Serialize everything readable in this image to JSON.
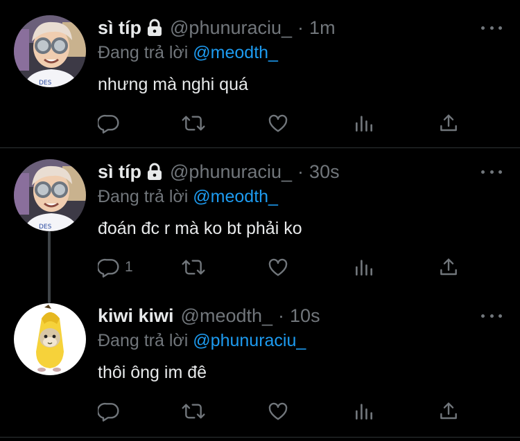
{
  "tweets": [
    {
      "name": "sì típ",
      "handle": "@phunuraciu_",
      "time": "1m",
      "locked": true,
      "replying_prefix": "Đang trả lời",
      "replying_to": "@meodth_",
      "text": "nhưng mà nghi quá",
      "reply_count": "",
      "avatar": "boy-with-goggles-photo"
    },
    {
      "name": "sì típ",
      "handle": "@phunuraciu_",
      "time": "30s",
      "locked": true,
      "replying_prefix": "Đang trả lời",
      "replying_to": "@meodth_",
      "text": "đoán đc r mà ko bt phải ko",
      "reply_count": "1",
      "avatar": "boy-with-goggles-photo"
    },
    {
      "name": "kiwi kiwi",
      "handle": "@meodth_",
      "time": "10s",
      "locked": false,
      "replying_prefix": "Đang trả lời",
      "replying_to": "@phunuraciu_",
      "text": "thôi ông im đê",
      "reply_count": "",
      "avatar": "banana-cat-image"
    }
  ],
  "separator": "·",
  "icons": {
    "reply": "reply-icon",
    "retweet": "retweet-icon",
    "like": "heart-icon",
    "analytics": "analytics-icon",
    "share": "share-icon",
    "more": "more-icon",
    "lock": "lock-icon"
  },
  "colors": {
    "background": "#000000",
    "text": "#e7e9ea",
    "secondary": "#71767b",
    "accent": "#1d9bf0",
    "divider": "#2f3336"
  }
}
